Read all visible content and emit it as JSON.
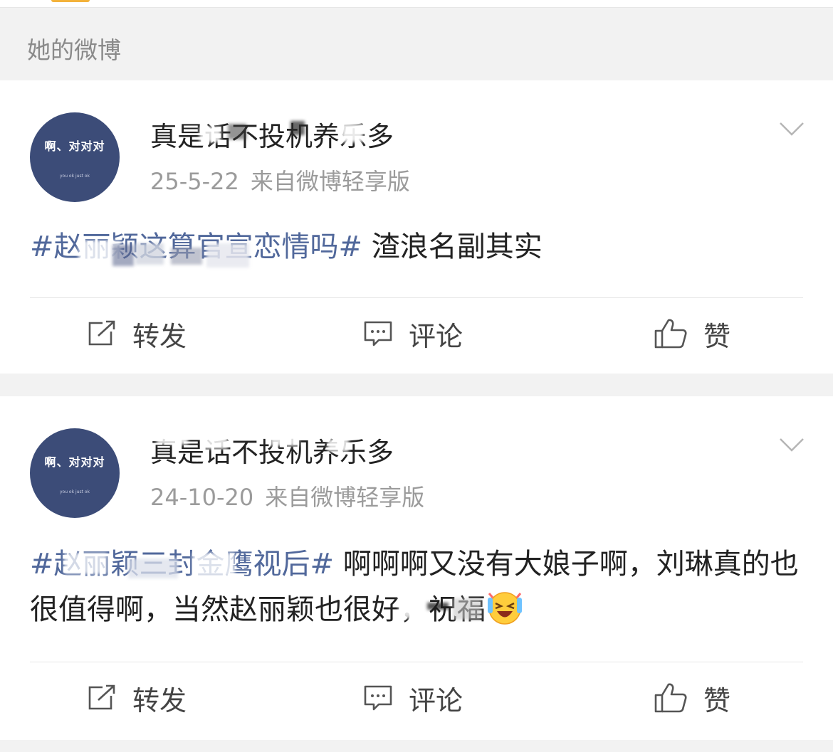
{
  "section": {
    "title": "她的微博"
  },
  "posts": [
    {
      "avatar_text": "啊、对对对",
      "avatar_subtext": "you ok just ok",
      "username": "真是话不投机养乐多",
      "date": "25-5-22",
      "source": "来自微博轻享版",
      "hashtag": "#赵丽颖这算官宣恋情吗#",
      "text": " 渣浪名副其实"
    },
    {
      "avatar_text": "啊、对对对",
      "avatar_subtext": "you ok just ok",
      "username": "真是话不投机养乐多",
      "date": "24-10-20",
      "source": "来自微博轻享版",
      "hashtag": "#赵丽颖三封金鹰视后#",
      "text": " 啊啊啊又没有大娘子啊，刘琳真的也很值得啊，当然赵丽颖也很好，祝福"
    }
  ],
  "actions": {
    "repost": "转发",
    "comment": "评论",
    "like": "赞"
  },
  "colors": {
    "hashtag": "#51689b",
    "avatar_bg": "#3c4c78",
    "header_bg": "#f2f2f2",
    "accent": "#f3b23a"
  }
}
